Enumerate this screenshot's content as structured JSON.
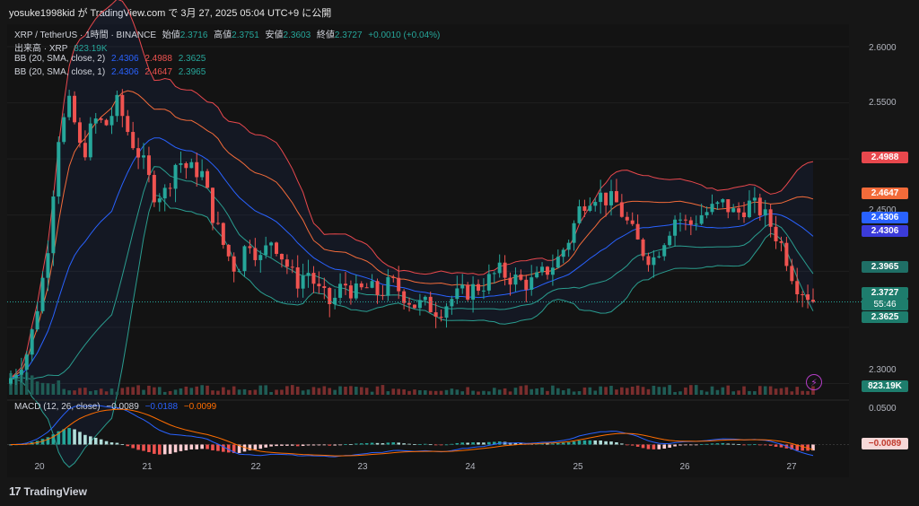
{
  "header": "yosuke1998kid が TradingView.com で 3月 27, 2025 05:04 UTC+9 に公開",
  "symbol_line": {
    "symbol": "XRP / TetherUS · 1時間 · BINANCE",
    "open_label": "始値",
    "open": "2.3716",
    "high_label": "高値",
    "high": "2.3751",
    "low_label": "安値",
    "low": "2.3603",
    "close_label": "終値",
    "close": "2.3727",
    "change": "+0.0010 (+0.04%)"
  },
  "volume_line": {
    "label": "出来高 · XRP",
    "value": "823.19K"
  },
  "bb1_line": {
    "label": "BB (20, SMA, close, 2)",
    "basis": "2.4306",
    "upper": "2.4988",
    "lower": "2.3625"
  },
  "bb2_line": {
    "label": "BB (20, SMA, close, 1)",
    "basis": "2.4306",
    "upper": "2.4647",
    "lower": "2.3965"
  },
  "macd_line": {
    "label": "MACD (12, 26, close)",
    "hist": "−0.0089",
    "macd": "−0.0188",
    "signal": "−0.0099"
  },
  "price_axis": [
    "2.6000",
    "2.5500",
    "2.4500",
    "2.3000"
  ],
  "macd_axis": [
    "0.0500"
  ],
  "price_tags": {
    "bb_upper_2": "2.4988",
    "bb_upper_1": "2.4647",
    "bb_basis_a": "2.4306",
    "bb_basis_b": "2.4306",
    "bb_lower_1": "2.3965",
    "last_price": "2.3727",
    "countdown": "55:46",
    "bb_lower_2": "2.3625",
    "volume": "823.19K",
    "macd_value": "−0.0089"
  },
  "time_axis": [
    "20",
    "21",
    "22",
    "23",
    "24",
    "25",
    "26",
    "27"
  ],
  "branding": "TradingView",
  "colors": {
    "up": "#26a69a",
    "down": "#ef5350",
    "upper2": "#e8484d",
    "upper1": "#f26b3a",
    "basis": "#2962ff",
    "lower1": "#2a9d8f",
    "macd": "#2962ff",
    "signal": "#ff6d00"
  },
  "chart_data": {
    "type": "candlestick",
    "title": "XRP / TetherUS · 1時間 · BINANCE",
    "ylim": [
      2.29,
      2.62
    ],
    "x_ticks": [
      "20",
      "21",
      "22",
      "23",
      "24",
      "25",
      "26",
      "27"
    ],
    "close_path": [
      [
        0,
        2.305
      ],
      [
        3,
        2.33
      ],
      [
        6,
        2.41
      ],
      [
        8,
        2.52
      ],
      [
        10,
        2.55
      ],
      [
        12,
        2.5
      ],
      [
        14,
        2.535
      ],
      [
        16,
        2.53
      ],
      [
        18,
        2.55
      ],
      [
        20,
        2.52
      ],
      [
        22,
        2.5
      ],
      [
        24,
        2.47
      ],
      [
        26,
        2.47
      ],
      [
        28,
        2.5
      ],
      [
        30,
        2.49
      ],
      [
        32,
        2.49
      ],
      [
        34,
        2.45
      ],
      [
        36,
        2.42
      ],
      [
        38,
        2.4
      ],
      [
        40,
        2.43
      ],
      [
        42,
        2.41
      ],
      [
        44,
        2.43
      ],
      [
        46,
        2.41
      ],
      [
        48,
        2.39
      ],
      [
        50,
        2.4
      ],
      [
        52,
        2.38
      ],
      [
        54,
        2.37
      ],
      [
        56,
        2.39
      ],
      [
        58,
        2.38
      ],
      [
        60,
        2.385
      ],
      [
        62,
        2.38
      ],
      [
        64,
        2.39
      ],
      [
        66,
        2.38
      ],
      [
        68,
        2.37
      ],
      [
        70,
        2.37
      ],
      [
        72,
        2.365
      ],
      [
        74,
        2.375
      ],
      [
        76,
        2.38
      ],
      [
        78,
        2.385
      ],
      [
        80,
        2.39
      ],
      [
        82,
        2.4
      ],
      [
        84,
        2.395
      ],
      [
        86,
        2.39
      ],
      [
        88,
        2.39
      ],
      [
        90,
        2.4
      ],
      [
        92,
        2.41
      ],
      [
        94,
        2.43
      ],
      [
        96,
        2.46
      ],
      [
        98,
        2.47
      ],
      [
        100,
        2.465
      ],
      [
        102,
        2.46
      ],
      [
        104,
        2.44
      ],
      [
        106,
        2.42
      ],
      [
        108,
        2.41
      ],
      [
        110,
        2.43
      ],
      [
        112,
        2.45
      ],
      [
        114,
        2.44
      ],
      [
        116,
        2.45
      ],
      [
        118,
        2.455
      ],
      [
        120,
        2.46
      ],
      [
        122,
        2.45
      ],
      [
        124,
        2.46
      ],
      [
        126,
        2.455
      ],
      [
        128,
        2.44
      ],
      [
        130,
        2.42
      ],
      [
        132,
        2.39
      ],
      [
        134,
        2.38
      ],
      [
        135,
        2.3727
      ]
    ],
    "bb_upper_2_end": 2.4988,
    "bb_upper_1_end": 2.4647,
    "bb_basis_end": 2.4306,
    "bb_lower_1_end": 2.3965,
    "bb_lower_2_end": 2.3625,
    "last_price": 2.3727,
    "volume_last": "823.19K",
    "macd": {
      "hist_last": -0.0089,
      "macd_last": -0.0188,
      "signal_last": -0.0099,
      "ylim": [
        -0.02,
        0.06
      ]
    }
  }
}
